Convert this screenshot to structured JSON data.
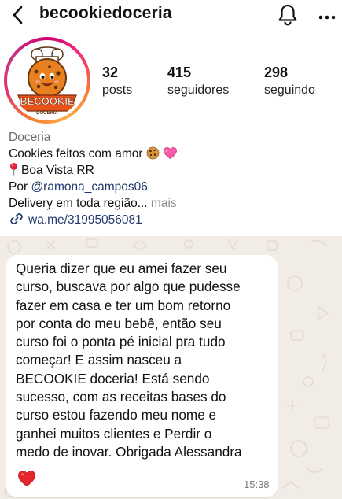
{
  "header": {
    "username": "becookiedoceria",
    "back_icon": "chevron-left-icon",
    "notification_icon": "bell-icon",
    "more_icon": "more-horizontal-icon"
  },
  "avatar": {
    "logo_text": "BECOOKIE",
    "logo_subtext": "DOCERIA"
  },
  "stats": {
    "posts": {
      "value": "32",
      "label": "posts"
    },
    "followers": {
      "value": "415",
      "label": "seguidores"
    },
    "following": {
      "value": "298",
      "label": "seguindo"
    }
  },
  "bio": {
    "category": "Doceria",
    "line1": "Cookies feitos com amor",
    "line2": "Boa Vista RR",
    "line3_prefix": "Por ",
    "mention": "@ramona_campos06",
    "line4": "Delivery em toda região...",
    "more_label": " mais",
    "link": "wa.me/31995056081"
  },
  "message": {
    "lines": [
      "Queria dizer que eu amei fazer seu",
      "curso, buscava por algo que pudesse",
      "fazer em casa e ter um bom retorno",
      "por conta do meu bebê, então seu",
      "curso foi o ponta pé inicial pra tudo",
      "começar! E assim nasceu a",
      "BECOOKIE doceria! Está sendo",
      "sucesso, com as receitas bases do",
      "curso estou fazendo meu nome e",
      "ganhei muitos clientes e Perdir o",
      "medo de inovar. Obrigada Alessandra"
    ],
    "time": "15:38"
  },
  "colors": {
    "link_blue": "#20396e",
    "chat_background": "#f1ece5",
    "bubble": "#ffffff",
    "story_ring": "#e1306c"
  }
}
